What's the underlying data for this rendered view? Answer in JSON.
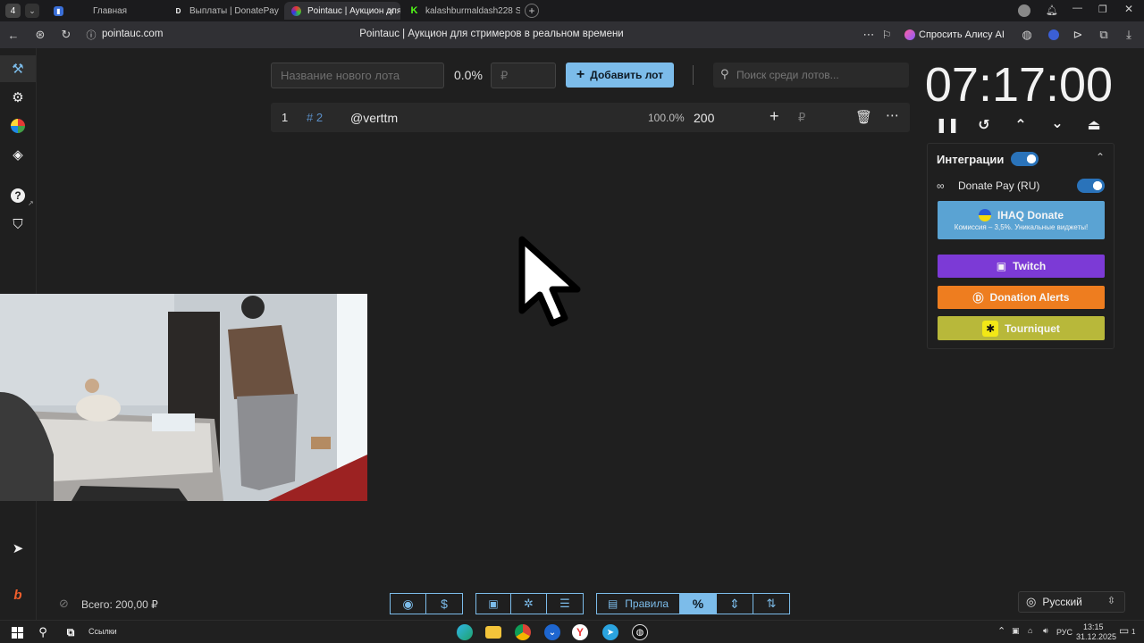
{
  "browser": {
    "tab_count": "4",
    "tabs": [
      {
        "label": "Главная",
        "active": false
      },
      {
        "label": "Выплаты | DonatePay",
        "active": false
      },
      {
        "label": "Pointauc | Аукцион для",
        "active": true
      },
      {
        "label": "kalashburmaldash228 Stre",
        "active": false
      }
    ],
    "url": "pointauc.com",
    "page_title": "Pointauc | Аукцион для стримеров в реальном времени",
    "alice_label": "Спросить Алису AI"
  },
  "controls": {
    "new_lot_placeholder": "Название нового лота",
    "percent": "0.0%",
    "amount_placeholder": "₽",
    "add_lot_label": "Добавить лот",
    "search_placeholder": "Поиск среди лотов..."
  },
  "lots": [
    {
      "index": "1",
      "id": "# 2",
      "name": "@verttm",
      "percent": "100.0%",
      "amount": "200",
      "currency": "₽"
    }
  ],
  "timer": {
    "value": "07:17:00"
  },
  "integrations": {
    "title": "Интеграции",
    "donate_pay_label": "Donate Pay (RU)",
    "ihaq": {
      "title": "IHAQ Donate",
      "subtitle": "Комиссия – 3,5%. Уникальные виджеты!"
    },
    "services": [
      "Twitch",
      "Donation Alerts",
      "Tourniquet"
    ]
  },
  "footer": {
    "total": "Всего: 200,00 ₽",
    "rules_label": "Правила",
    "percent_symbol": "%",
    "language": "Русский"
  },
  "taskbar": {
    "links_label": "Ссылки",
    "lang": "РУС",
    "time": "13:15",
    "date": "31.12.2025",
    "notification_count": "1"
  },
  "colors": {
    "accent": "#7cbcea",
    "toggle": "#2a73ba",
    "twitch": "#7c3ad6",
    "donation_alerts": "#ee7d1f",
    "tourniquet": "#b8b83a",
    "ihaq": "#5aa3d3"
  }
}
